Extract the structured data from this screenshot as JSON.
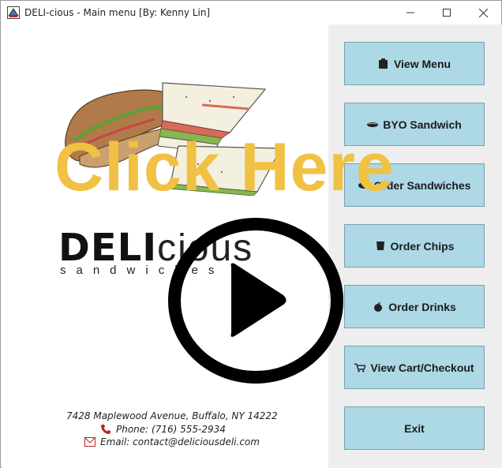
{
  "window": {
    "title": "DELI-cious - Main menu [By: Kenny Lin]"
  },
  "logo": {
    "bold_part": "DELI",
    "light_part": "cious",
    "tagline": "sandwiches"
  },
  "contact": {
    "address": "7428 Maplewood Avenue, Buffalo, NY 14222",
    "phone": "Phone: (716) 555-2934",
    "email": "Email: contact@deliciousdeli.com"
  },
  "menu": {
    "view_menu": "View Menu",
    "byo_sandwich": "BYO Sandwich",
    "order_sandwiches": "Order Sandwiches",
    "order_chips": "Order Chips",
    "order_drinks": "Order Drinks",
    "view_cart": "View Cart/Checkout",
    "exit": "Exit"
  },
  "overlay": {
    "caption": "Click Here"
  },
  "colors": {
    "button_bg": "#add8e6",
    "sidebar_bg": "#eeeeee",
    "overlay_yellow": "#f0c143"
  }
}
